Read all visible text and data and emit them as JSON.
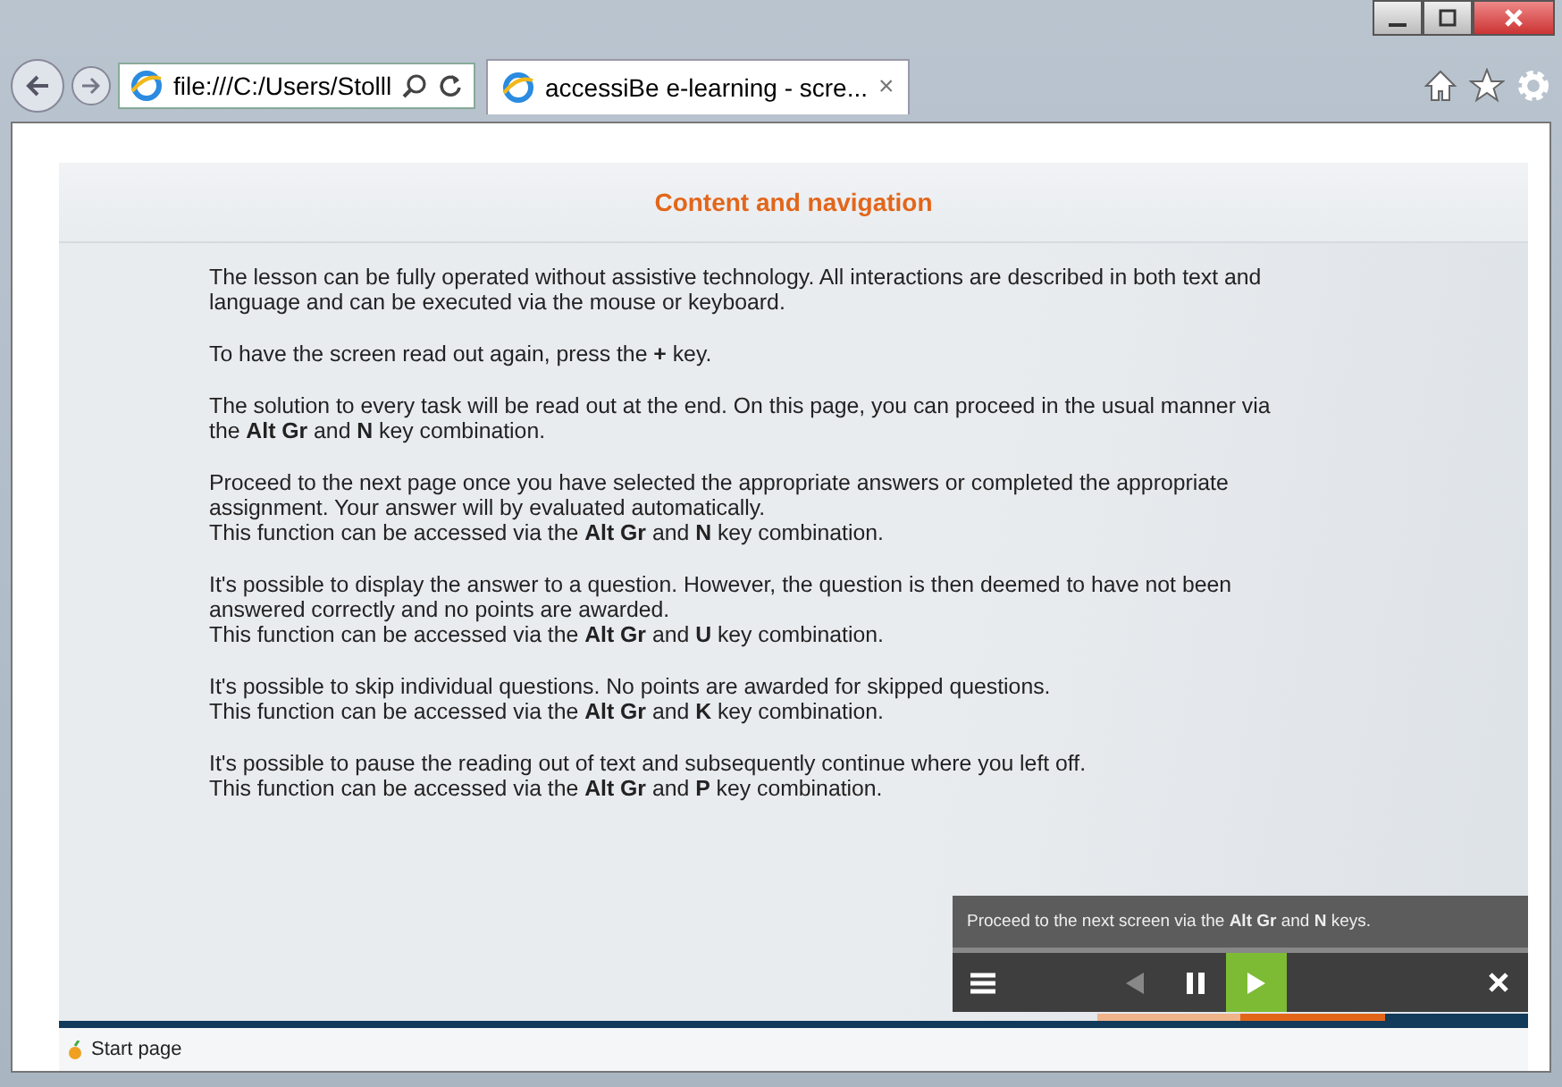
{
  "browser": {
    "address": "file:///C:/Users/Stolll",
    "tab_title": "accessiBe e-learning - scre...",
    "tab_close": "×"
  },
  "page": {
    "title": "Content and navigation",
    "paragraphs": [
      "The lesson can be fully operated without assistive technology. All interactions are described in both text and language and can be executed via the mouse or keyboard.",
      "To have the screen read out again, press the **+** key.",
      "The solution to every task will be read out at the end. On this page, you can proceed in the usual manner via the **Alt Gr** and **N** key combination.",
      "Proceed to the next page once you have selected the appropriate answers or completed the appropriate assignment. Your answer will by evaluated automatically.\nThis function can be accessed via the **Alt Gr** and **N** key combination.",
      "It's possible to display the answer to a question. However, the question is then deemed to have not been answered correctly and no points are awarded.\nThis function can be accessed via the **Alt Gr** and **U** key combination.",
      "It's possible to skip individual questions. No points are awarded for skipped questions.\nThis function can be accessed via the **Alt Gr** and **K** key combination.",
      "It's possible to pause the reading out of text and subsequently continue where you left off.\nThis function can be accessed via the **Alt Gr** and **P** key combination."
    ]
  },
  "player": {
    "hint": "Proceed to the next screen via the **Alt Gr** and **N** keys.",
    "play_active": true
  },
  "footer": {
    "start_link": "Start page"
  }
}
